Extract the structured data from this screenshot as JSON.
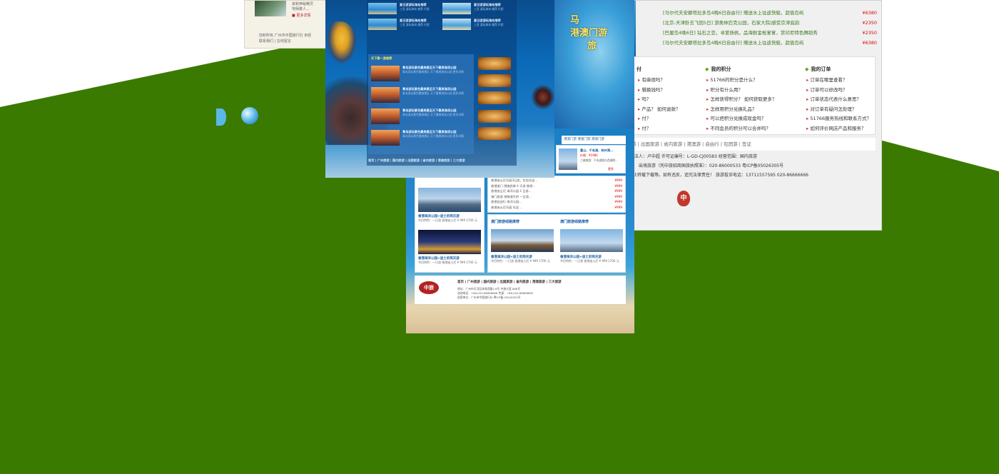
{
  "colors": {
    "background_green": "#3b7a00",
    "background_white": "#ffffff",
    "accent_red": "#dd0000",
    "link_green": "#3a7a1a"
  },
  "left_page": {
    "line1": "家和神秘精灵",
    "line2": "地柄着人...",
    "more": "■ 更多详情",
    "footer1": "前积所有  广州市中国旅行社 未经",
    "footer2": "联系我们 | 在线留言"
  },
  "right_page": {
    "routes": [
      {
        "text": "[马尔代夫安娜塔拉多岛4晚6日自由行]  赠送水上往返快艇，超值岛屿",
        "price": "¥6380"
      },
      {
        "text": "[北京-天津卧去飞回5日]  游奥林匹克公园，石家大院|感受京津底韵",
        "price": "¥2350"
      },
      {
        "text": "[巴厘岛4晚6日]  钻石之恋，寻爱扬帆，品海鲜金枪宴宴，赏印尼特色舞蹈秀",
        "price": "¥2350"
      },
      {
        "text": "[马尔代夫安娜塔拉多岛4晚6日自由行]  赠送水上往返快艇，超值岛屿",
        "price": "¥6380"
      }
    ],
    "col1": {
      "title": "付",
      "items": [
        "有麻烦吗？",
        "辑换钱吗？",
        "吗？",
        "产品？ 如何退款？",
        "付？",
        "付？"
      ]
    },
    "col2": {
      "title": "我的积分",
      "items": [
        "51766的积分是什么？",
        "积分有什么用？",
        "怎样获得积分？ 如何获取更多？",
        "怎样用积分兑换礼品？",
        "可以把积分兑换成现金吗？",
        "不同会员的积分可以合并吗？"
      ]
    },
    "col3": {
      "title": "我的订单",
      "items": [
        "订单在哪里查看？",
        "订单可以修改吗？",
        "订单状态代表什么意思？",
        "对订单有疑问怎处理？",
        "51766服务热线和联系方式？",
        "如何评价网店产品和服务？"
      ]
    },
    "nav": "游 | 出国旅游 | 省内旅游 | 港澳游 | 自由行 | 包团游 | 签证",
    "footer_line1": "社  法人：卢中超  许可证编号：L-GD-CJ00583   经营范围：国内旅游",
    "footer_line2": "区）   出境旅游（凭中旅招商国旅执照准）：020-86000533        粤ICP备05026305号",
    "footer_line3": "禁止转载下载等。如有违反，追究法律责任！   旅游投诉电话：13711557595    020-86666666",
    "seal": "中"
  },
  "mid_page": {
    "title_line1": "马",
    "title_line2": "港澳门游",
    "title_line3": "旅",
    "nav": "港澳门游    港澳门游    港澳门游",
    "card_title": "富山、千岛湖、杭州湾...",
    "card_price": "价格：¥1980",
    "card_desc": "三峡旅游：千岛湖游与西湖的...",
    "card_more": "更多",
    "prices": [
      {
        "text": "香港迪士尼乐园3日游，包含往返...",
        "price": "¥999"
      },
      {
        "text": "香港澳门 港澳经典 4 天游 香港...",
        "price": "¥999"
      },
      {
        "text": "香港迪士尼 海洋公园 2 日游...",
        "price": "¥999"
      },
      {
        "text": "澳门旅游 港珠澳大桥 一日游...",
        "price": "¥999"
      },
      {
        "text": "香港自由行 海洋公园...",
        "price": "¥999"
      },
      {
        "text": "香港迪士尼乐园 往返 ...",
        "price": "¥999"
      }
    ],
    "hk1_caption": "香港海洋公园+迪士尼两天游",
    "hk2_caption": "香港海洋公园+迪士尼两天游",
    "macau_title": "澳门旅游线路推荐",
    "macau_title2": "澳门旅游线路推荐",
    "mac1_caption": "香港海洋公园+迪士尼两天游",
    "mac2_caption": "香港海洋公园+迪士尼两天游",
    "small_desc": "节目特色：一日游 香港迪士尼 ¥ 999 1700 元",
    "footer_nav": "首页 | 广州旅游 | 国内旅游 | 出国旅游 | 省内旅游 | 港澳旅游 | 三大旅游",
    "footer_addr1": "地址：广州市天河区体育西路2-6号 中旅大厦 888号",
    "footer_addr2": "咨询电话：+86-020-86666666    传真：+86-020-86666665",
    "footer_addr3": "经营单位：广州市中国旅行社 粤ICP备 05026305号",
    "logo": "中旅"
  },
  "front_page": {
    "section_header": "天下第一游推荐",
    "items": [
      {
        "title": "夏日游游玩海岛推荐",
        "desc": "三亚 游玩海岛 推荐 行程"
      },
      {
        "title": "夏日游游玩海岛推荐",
        "desc": "三亚 游玩海岛 推荐 行程"
      },
      {
        "title": "夏日游游玩海岛推荐",
        "desc": "三亚 游玩海岛 推荐 行程"
      },
      {
        "title": "夏日游游玩海岛推荐",
        "desc": "三亚 游玩海岛 推荐 行程"
      }
    ],
    "list": [
      {
        "title": "青岛游玩景色最美景区天下最美海滨公园",
        "desc": "青岛游玩景色最美景区 天下最美海滨公园 更多详情"
      },
      {
        "title": "青岛游玩景色最美景区天下最美海滨公园",
        "desc": "青岛游玩景色最美景区 天下最美海滨公园 更多详情"
      },
      {
        "title": "青岛游玩景色最美景区天下最美海滨公园",
        "desc": "青岛游玩景色最美景区 天下最美海滨公园 更多详情"
      },
      {
        "title": "青岛游玩景色最美景区天下最美海滨公园",
        "desc": "青岛游玩景色最美景区 天下最美海滨公园 更多详情"
      }
    ],
    "footer": "首页 | 广州旅游 | 国内旅游 | 出国旅游 | 省内旅游 | 港澳旅游 | 三大旅游"
  }
}
